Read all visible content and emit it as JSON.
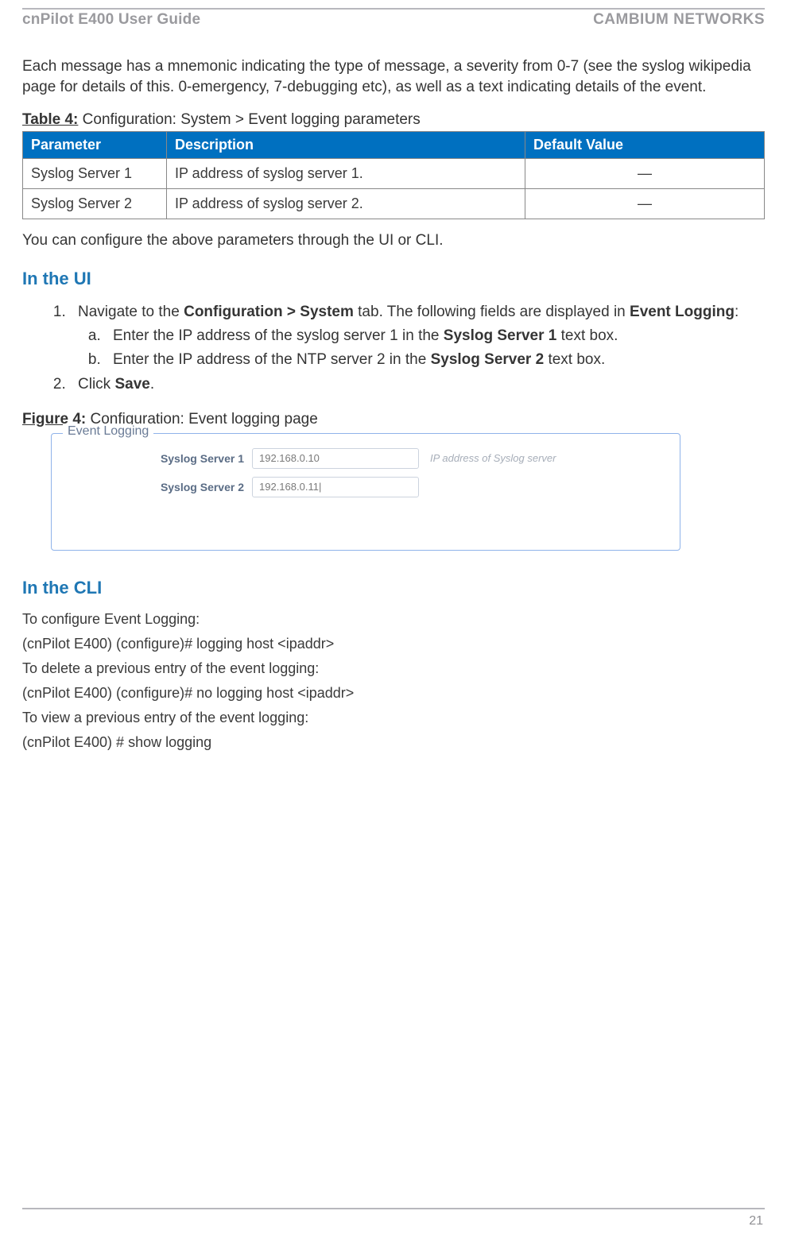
{
  "header": {
    "left": "cnPilot E400 User Guide",
    "right": "CAMBIUM NETWORKS"
  },
  "intro": "Each message has a mnemonic indicating the type of message, a severity from 0-7 (see the syslog wikipedia page for details of this. 0-emergency, 7-debugging etc), as well as a text indicating details of the event.",
  "table": {
    "caption_prefix": "Table 4:",
    "caption_rest": " Configuration: System > Event logging parameters",
    "headers": {
      "param": "Parameter",
      "desc": "Description",
      "def": "Default Value"
    },
    "rows": [
      {
        "param": "Syslog Server 1",
        "desc": "IP address of syslog server 1.",
        "def": "—"
      },
      {
        "param": "Syslog Server 2",
        "desc": "IP address of syslog server 2.",
        "def": "—"
      }
    ]
  },
  "after_table": "You can configure the above parameters through the UI or CLI.",
  "ui_heading": "In the UI",
  "steps": {
    "s1_a": "Navigate to the ",
    "s1_b": "Configuration > System",
    "s1_c": " tab. The following fields are displayed in ",
    "s1_d": "Event Logging",
    "s1_e": ":",
    "s1a_a": "Enter the IP address of the syslog server 1 in the ",
    "s1a_b": "Syslog Server 1",
    "s1a_c": " text box.",
    "s1b_a": "Enter the IP address of the NTP server 2 in the ",
    "s1b_b": "Syslog Server 2",
    "s1b_c": " text box.",
    "s2_a": "Click ",
    "s2_b": "Save",
    "s2_c": "."
  },
  "figure": {
    "caption_prefix": "Figure 4:",
    "caption_rest": " Configuration: Event logging page",
    "legend": "Event Logging",
    "row1_label": "Syslog Server 1",
    "row1_value": "192.168.0.10",
    "row1_hint": "IP address of Syslog server",
    "row2_label": "Syslog Server 2",
    "row2_value": "192.168.0.11|"
  },
  "cli_heading": "In the CLI",
  "cli": {
    "l1": "To configure Event Logging:",
    "l2": "(cnPilot E400) (configure)# logging host <ipaddr>",
    "l3": "To delete a previous entry of the event logging:",
    "l4": "(cnPilot E400) (configure)# no logging host <ipaddr>",
    "l5": "To view a previous entry of the event logging:",
    "l6": "(cnPilot E400) # show logging"
  },
  "page_number": "21"
}
